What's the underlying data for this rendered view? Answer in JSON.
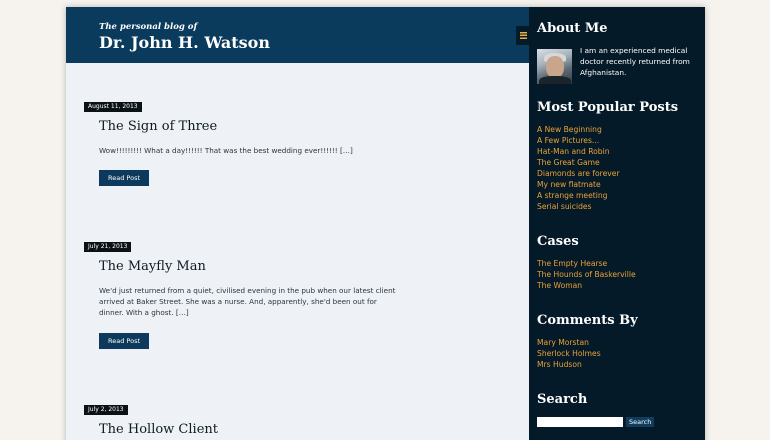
{
  "header": {
    "tagline": "The personal blog of",
    "title": "Dr. John H. Watson",
    "menu_icon": "hamburger-menu-icon"
  },
  "posts": [
    {
      "date": "August 11, 2013",
      "title": "The Sign of Three",
      "excerpt": "Wow!!!!!!!!! What a day!!!!!! That was the best wedding ever!!!!!! […]",
      "button": "Read Post"
    },
    {
      "date": "July 21, 2013",
      "title": "The Mayfly Man",
      "excerpt": "We'd just returned from a quiet, civilised evening in the pub when our latest client arrived at Baker Street. She was a nurse. And, apparently, she'd been out for dinner. With a ghost. […]",
      "button": "Read Post"
    },
    {
      "date": "July 2, 2013",
      "title": "The Hollow Client"
    }
  ],
  "sidebar": {
    "about": {
      "title": "About Me",
      "text": "I am an experienced medical doctor recently returned from Afghanistan."
    },
    "popular": {
      "title": "Most Popular Posts",
      "items": [
        "A New Beginning",
        "A Few Pictures...",
        "Hat-Man and Robin",
        "The Great Game",
        "Diamonds are forever",
        "My new flatmate",
        "A strange meeting",
        "Serial suicides"
      ]
    },
    "cases": {
      "title": "Cases",
      "items": [
        "The Empty Hearse",
        "The Hounds of Baskerville",
        "The Woman"
      ]
    },
    "comments": {
      "title": "Comments By",
      "items": [
        "Mary Morstan",
        "Sherlock Holmes",
        "Mrs Hudson"
      ]
    },
    "search": {
      "title": "Search",
      "input_value": "",
      "button": "Search"
    }
  },
  "colors": {
    "header_bg": "#0a3a5c",
    "sidebar_bg": "#051a28",
    "link": "#e8a23a",
    "button_bg": "#0d3a5c",
    "content_bg": "#eef1f5",
    "page_bg": "#f6f3ee"
  }
}
